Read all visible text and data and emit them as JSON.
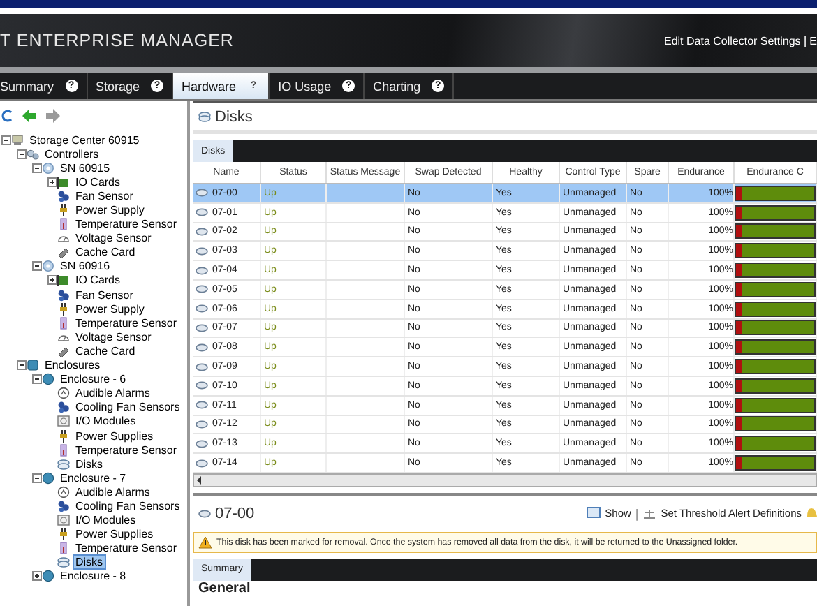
{
  "header": {
    "title": "T ENTERPRISE MANAGER",
    "links": [
      "Edit Data Collector Settings",
      "E"
    ],
    "separator": "|"
  },
  "tabs": [
    {
      "label": "Summary",
      "help": "?",
      "selected": false
    },
    {
      "label": "Storage",
      "help": "?",
      "selected": false
    },
    {
      "label": "Hardware",
      "help": "?",
      "selected": true
    },
    {
      "label": "IO Usage",
      "help": "?",
      "selected": false
    },
    {
      "label": "Charting",
      "help": "?",
      "selected": false
    }
  ],
  "tree": [
    {
      "label": "Storage Center 60915",
      "kind": "storage-center",
      "expanded": true,
      "selected": false,
      "children": [
        {
          "label": "Controllers",
          "kind": "controllers",
          "expanded": true,
          "selected": false,
          "children": [
            {
              "label": "SN 60915",
              "kind": "controller",
              "expanded": true,
              "selected": false,
              "children": [
                {
                  "label": "IO Cards",
                  "kind": "io-cards",
                  "expanded": false,
                  "selected": false
                },
                {
                  "label": "Fan Sensor",
                  "kind": "fan",
                  "selected": false
                },
                {
                  "label": "Power Supply",
                  "kind": "power",
                  "selected": false
                },
                {
                  "label": "Temperature Sensor",
                  "kind": "temperature",
                  "selected": false
                },
                {
                  "label": "Voltage Sensor",
                  "kind": "voltage",
                  "selected": false
                },
                {
                  "label": "Cache Card",
                  "kind": "cache",
                  "selected": false
                }
              ]
            },
            {
              "label": "SN 60916",
              "kind": "controller",
              "expanded": true,
              "selected": false,
              "children": [
                {
                  "label": "IO Cards",
                  "kind": "io-cards",
                  "expanded": false,
                  "selected": false
                },
                {
                  "label": "Fan Sensor",
                  "kind": "fan",
                  "selected": false
                },
                {
                  "label": "Power Supply",
                  "kind": "power",
                  "selected": false
                },
                {
                  "label": "Temperature Sensor",
                  "kind": "temperature",
                  "selected": false
                },
                {
                  "label": "Voltage Sensor",
                  "kind": "voltage",
                  "selected": false
                },
                {
                  "label": "Cache Card",
                  "kind": "cache",
                  "selected": false
                }
              ]
            }
          ]
        },
        {
          "label": "Enclosures",
          "kind": "enclosures",
          "expanded": true,
          "selected": false,
          "children": [
            {
              "label": "Enclosure - 6",
              "kind": "enclosure",
              "expanded": true,
              "selected": false,
              "children": [
                {
                  "label": "Audible Alarms",
                  "kind": "alarm",
                  "selected": false
                },
                {
                  "label": "Cooling Fan Sensors",
                  "kind": "fan",
                  "selected": false
                },
                {
                  "label": "I/O Modules",
                  "kind": "io-modules",
                  "selected": false
                },
                {
                  "label": "Power Supplies",
                  "kind": "power",
                  "selected": false
                },
                {
                  "label": "Temperature Sensor",
                  "kind": "temperature",
                  "selected": false
                },
                {
                  "label": "Disks",
                  "kind": "disks",
                  "selected": false
                }
              ]
            },
            {
              "label": "Enclosure - 7",
              "kind": "enclosure",
              "expanded": true,
              "selected": false,
              "children": [
                {
                  "label": "Audible Alarms",
                  "kind": "alarm",
                  "selected": false
                },
                {
                  "label": "Cooling Fan Sensors",
                  "kind": "fan",
                  "selected": false
                },
                {
                  "label": "I/O Modules",
                  "kind": "io-modules",
                  "selected": false
                },
                {
                  "label": "Power Supplies",
                  "kind": "power",
                  "selected": false
                },
                {
                  "label": "Temperature Sensor",
                  "kind": "temperature",
                  "selected": false
                },
                {
                  "label": "Disks",
                  "kind": "disks",
                  "selected": true
                }
              ]
            },
            {
              "label": "Enclosure - 8",
              "kind": "enclosure",
              "expanded": false,
              "selected": false
            }
          ]
        }
      ]
    }
  ],
  "panel": {
    "title": "Disks",
    "subtabs": [
      {
        "label": "Disks",
        "selected": true
      }
    ],
    "columns": [
      "Name",
      "Status",
      "Status Message",
      "Swap Detected",
      "Healthy",
      "Control Type",
      "Spare",
      "Endurance",
      "Endurance C"
    ],
    "rows": [
      {
        "name": "07-00",
        "status": "Up",
        "swap": "No",
        "healthy": "Yes",
        "control_type": "Unmanaged",
        "spare": "No",
        "endurance": "100%",
        "level": 1,
        "selected": true
      },
      {
        "name": "07-01",
        "status": "Up",
        "swap": "No",
        "healthy": "Yes",
        "control_type": "Unmanaged",
        "spare": "No",
        "endurance": "100%",
        "level": 1,
        "selected": false
      },
      {
        "name": "07-02",
        "status": "Up",
        "swap": "No",
        "healthy": "Yes",
        "control_type": "Unmanaged",
        "spare": "No",
        "endurance": "100%",
        "level": 1,
        "selected": false
      },
      {
        "name": "07-03",
        "status": "Up",
        "swap": "No",
        "healthy": "Yes",
        "control_type": "Unmanaged",
        "spare": "No",
        "endurance": "100%",
        "level": 1,
        "selected": false
      },
      {
        "name": "07-04",
        "status": "Up",
        "swap": "No",
        "healthy": "Yes",
        "control_type": "Unmanaged",
        "spare": "No",
        "endurance": "100%",
        "level": 1,
        "selected": false
      },
      {
        "name": "07-05",
        "status": "Up",
        "swap": "No",
        "healthy": "Yes",
        "control_type": "Unmanaged",
        "spare": "No",
        "endurance": "100%",
        "level": 1,
        "selected": false
      },
      {
        "name": "07-06",
        "status": "Up",
        "swap": "No",
        "healthy": "Yes",
        "control_type": "Unmanaged",
        "spare": "No",
        "endurance": "100%",
        "level": 1,
        "selected": false
      },
      {
        "name": "07-07",
        "status": "Up",
        "swap": "No",
        "healthy": "Yes",
        "control_type": "Unmanaged",
        "spare": "No",
        "endurance": "100%",
        "level": 1,
        "selected": false
      },
      {
        "name": "07-08",
        "status": "Up",
        "swap": "No",
        "healthy": "Yes",
        "control_type": "Unmanaged",
        "spare": "No",
        "endurance": "100%",
        "level": 1,
        "selected": false
      },
      {
        "name": "07-09",
        "status": "Up",
        "swap": "No",
        "healthy": "Yes",
        "control_type": "Unmanaged",
        "spare": "No",
        "endurance": "100%",
        "level": 1,
        "selected": false
      },
      {
        "name": "07-10",
        "status": "Up",
        "swap": "No",
        "healthy": "Yes",
        "control_type": "Unmanaged",
        "spare": "No",
        "endurance": "100%",
        "level": 1,
        "selected": false
      },
      {
        "name": "07-11",
        "status": "Up",
        "swap": "No",
        "healthy": "Yes",
        "control_type": "Unmanaged",
        "spare": "No",
        "endurance": "100%",
        "level": 1,
        "selected": false
      },
      {
        "name": "07-12",
        "status": "Up",
        "swap": "No",
        "healthy": "Yes",
        "control_type": "Unmanaged",
        "spare": "No",
        "endurance": "100%",
        "level": 1,
        "selected": false
      },
      {
        "name": "07-13",
        "status": "Up",
        "swap": "No",
        "healthy": "Yes",
        "control_type": "Unmanaged",
        "spare": "No",
        "endurance": "100%",
        "level": 1,
        "selected": false
      },
      {
        "name": "07-14",
        "status": "Up",
        "swap": "No",
        "healthy": "Yes",
        "control_type": "Unmanaged",
        "spare": "No",
        "endurance": "100%",
        "level": 1,
        "selected": false
      }
    ]
  },
  "detail": {
    "title": "07-00",
    "actions": [
      "Show",
      "Set Threshold Alert Definitions"
    ],
    "separator": "|",
    "warning": "This disk has been marked for removal. Once the system has removed all data from the disk, it will be returned to the Unassigned folder.",
    "tabs": [
      {
        "label": "Summary",
        "selected": true
      }
    ],
    "section": "General"
  }
}
